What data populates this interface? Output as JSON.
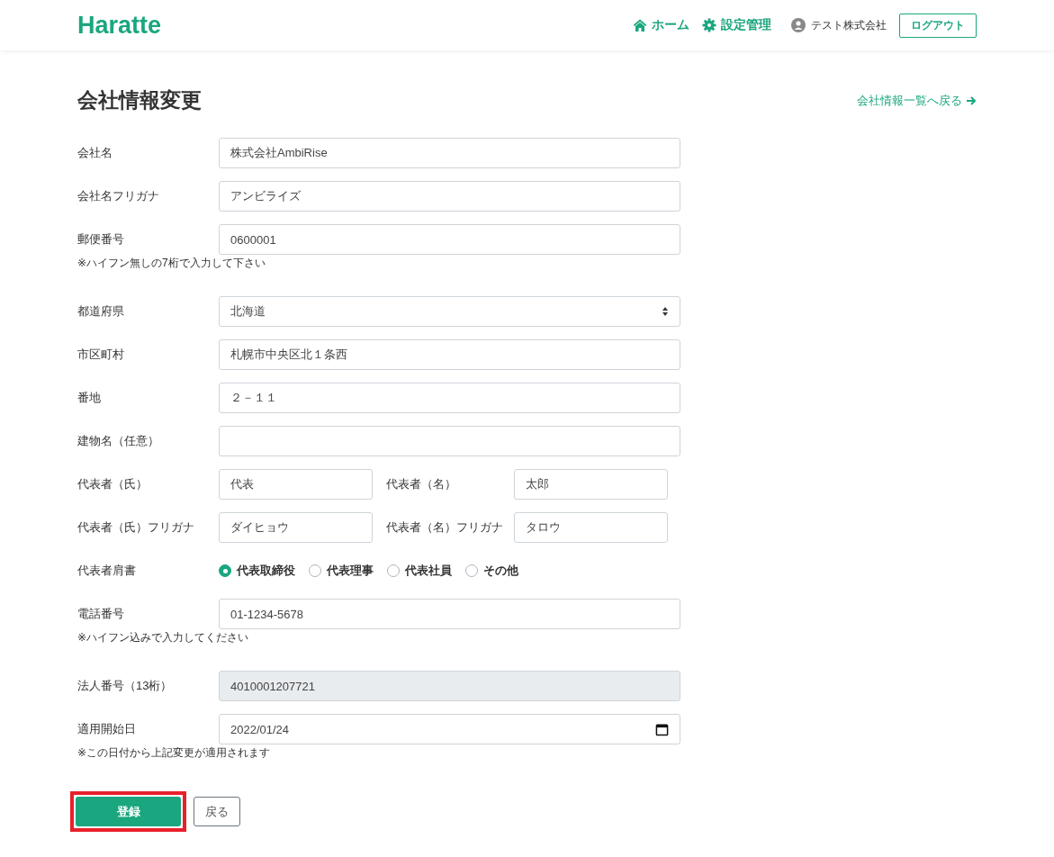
{
  "header": {
    "logo": "Haratte",
    "nav": [
      {
        "kind": "home",
        "label": "ホーム"
      },
      {
        "kind": "settings",
        "label": "設定管理"
      }
    ],
    "user": "テスト株式会社",
    "logout": "ログアウト"
  },
  "page": {
    "title": "会社情報変更",
    "back_link": "会社情報一覧へ戻る"
  },
  "fields": [
    {
      "kind": "text",
      "label": "会社名",
      "value": "株式会社AmbiRise"
    },
    {
      "kind": "text",
      "label": "会社名フリガナ",
      "value": "アンビライズ"
    },
    {
      "kind": "text",
      "label": "郵便番号",
      "value": "0600001",
      "hint": "※ハイフン無しの7桁で入力して下さい"
    },
    {
      "kind": "select",
      "label": "都道府県",
      "value": "北海道"
    },
    {
      "kind": "text",
      "label": "市区町村",
      "value": "札幌市中央区北１条西"
    },
    {
      "kind": "text",
      "label": "番地",
      "value": "２－１１"
    },
    {
      "kind": "text",
      "label": "建物名（任意）"
    },
    {
      "kind": "pair",
      "label": "代表者（氏）",
      "value": "代表",
      "label2": "代表者（名）",
      "value2": "太郎"
    },
    {
      "kind": "pair",
      "label": "代表者（氏）フリガナ",
      "value": "ダイヒョウ",
      "label2": "代表者（名）フリガナ",
      "value2": "タロウ"
    },
    {
      "kind": "radio",
      "label": "代表者肩書",
      "options": [
        {
          "label": "代表取締役",
          "selected": true
        },
        {
          "label": "代表理事",
          "selected": false
        },
        {
          "label": "代表社員",
          "selected": false
        },
        {
          "label": "その他",
          "selected": false
        }
      ]
    },
    {
      "kind": "text",
      "label": "電話番号",
      "value": "01-1234-5678",
      "hint": "※ハイフン込みで入力してください"
    },
    {
      "kind": "text",
      "label": "法人番号（13桁）",
      "value": "4010001207721",
      "disabled": true
    },
    {
      "kind": "date",
      "label": "適用開始日",
      "value": "2022/01/24",
      "hint": "※この日付から上記変更が適用されます"
    }
  ],
  "buttons": {
    "submit": "登録",
    "submit_highlighted": true,
    "back": "戻る"
  }
}
